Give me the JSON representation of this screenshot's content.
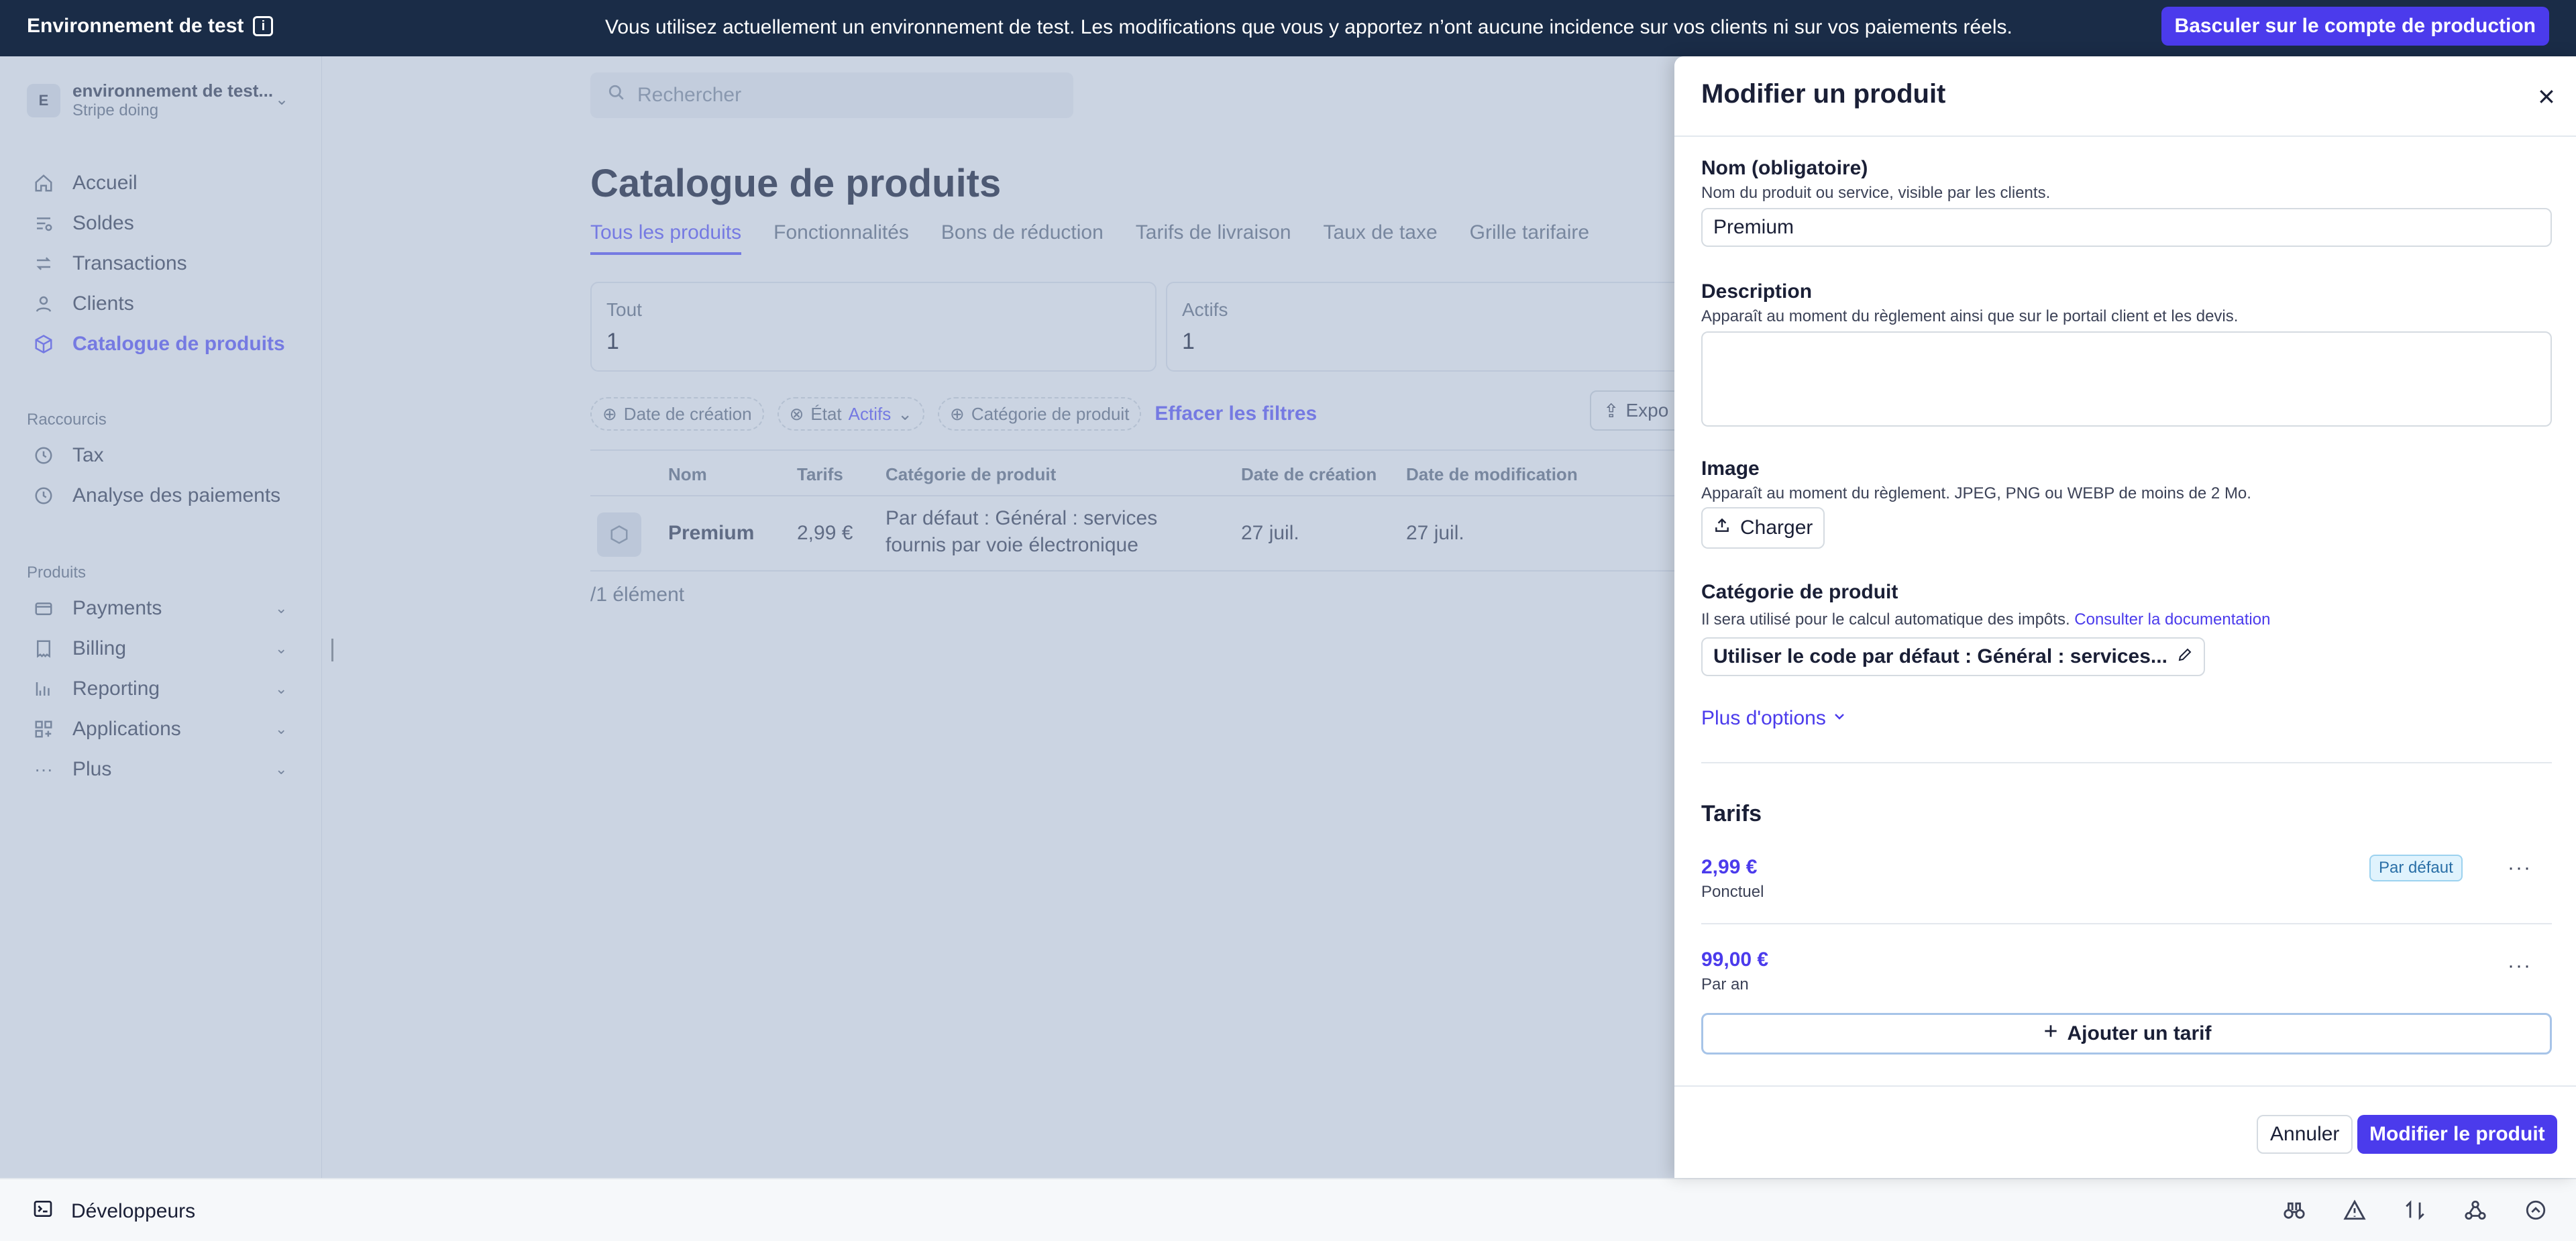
{
  "banner": {
    "env_label": "Environnement de test",
    "message": "Vous utilisez actuellement un environnement de test. Les modifications que vous y apportez n’ont aucune incidence sur vos clients ni sur vos paiements réels.",
    "switch_label": "Basculer sur le compte de production"
  },
  "account": {
    "initial": "E",
    "name": "environnement de test...",
    "sub": "Stripe doing"
  },
  "sidebar": {
    "items": [
      {
        "label": "Accueil",
        "icon": "home-icon"
      },
      {
        "label": "Soldes",
        "icon": "balances-icon"
      },
      {
        "label": "Transactions",
        "icon": "transactions-icon"
      },
      {
        "label": "Clients",
        "icon": "person-icon"
      },
      {
        "label": "Catalogue de produits",
        "icon": "box-icon"
      }
    ],
    "shortcuts_title": "Raccourcis",
    "shortcuts": [
      {
        "label": "Tax",
        "icon": "clock-icon"
      },
      {
        "label": "Analyse des paiements",
        "icon": "clock-icon"
      }
    ],
    "products_title": "Produits",
    "products": [
      {
        "label": "Payments",
        "icon": "wallet-icon"
      },
      {
        "label": "Billing",
        "icon": "billing-icon"
      },
      {
        "label": "Reporting",
        "icon": "chart-icon"
      },
      {
        "label": "Applications",
        "icon": "apps-icon"
      },
      {
        "label": "Plus",
        "icon": "more-icon"
      }
    ]
  },
  "main": {
    "search_placeholder": "Rechercher",
    "title": "Catalogue de produits",
    "tabs": [
      "Tous les produits",
      "Fonctionnalités",
      "Bons de réduction",
      "Tarifs de livraison",
      "Taux de taxe",
      "Grille tarifaire"
    ],
    "stats": [
      {
        "label": "Tout",
        "value": "1"
      },
      {
        "label": "Actifs",
        "value": "1"
      }
    ],
    "filters": {
      "created": "Date de création",
      "state": "État",
      "state_value": "Actifs",
      "category": "Catégorie de produit",
      "clear": "Effacer les filtres",
      "export": "Expo"
    },
    "table": {
      "headers": [
        "Nom",
        "Tarifs",
        "Catégorie de produit",
        "Date de création",
        "Date de modification"
      ],
      "rows": [
        {
          "name": "Premium",
          "price": "2,99 €",
          "category_line1": "Par défaut : Général : services",
          "category_line2": "fournis par voie électronique",
          "created": "27 juil.",
          "modified": "27 juil."
        }
      ],
      "count": "/1 élément"
    }
  },
  "drawer": {
    "title": "Modifier un produit",
    "name_label": "Nom (obligatoire)",
    "name_help": "Nom du produit ou service, visible par les clients.",
    "name_value": "Premium",
    "desc_label": "Description",
    "desc_help": "Apparaît au moment du règlement ainsi que sur le portail client et les devis.",
    "image_label": "Image",
    "image_help": "Apparaît au moment du règlement. JPEG, PNG ou WEBP de moins de 2 Mo.",
    "upload_label": "Charger",
    "category_label": "Catégorie de produit",
    "category_help": "Il sera utilisé pour le calcul automatique des impôts.",
    "category_link": "Consulter la documentation",
    "category_value": "Utiliser le code par défaut : Général : services...",
    "more_options": "Plus d'options",
    "prices_title": "Tarifs",
    "prices": [
      {
        "amount": "2,99 €",
        "recurrence": "Ponctuel",
        "default": "Par défaut"
      },
      {
        "amount": "99,00 €",
        "recurrence": "Par an"
      }
    ],
    "add_price": "Ajouter un tarif",
    "cancel": "Annuler",
    "submit": "Modifier le produit"
  },
  "devbar": {
    "label": "Développeurs"
  },
  "colors": {
    "accent": "#635bff",
    "primary_button": "#4b3bec",
    "banner_bg": "#1a2c47"
  }
}
